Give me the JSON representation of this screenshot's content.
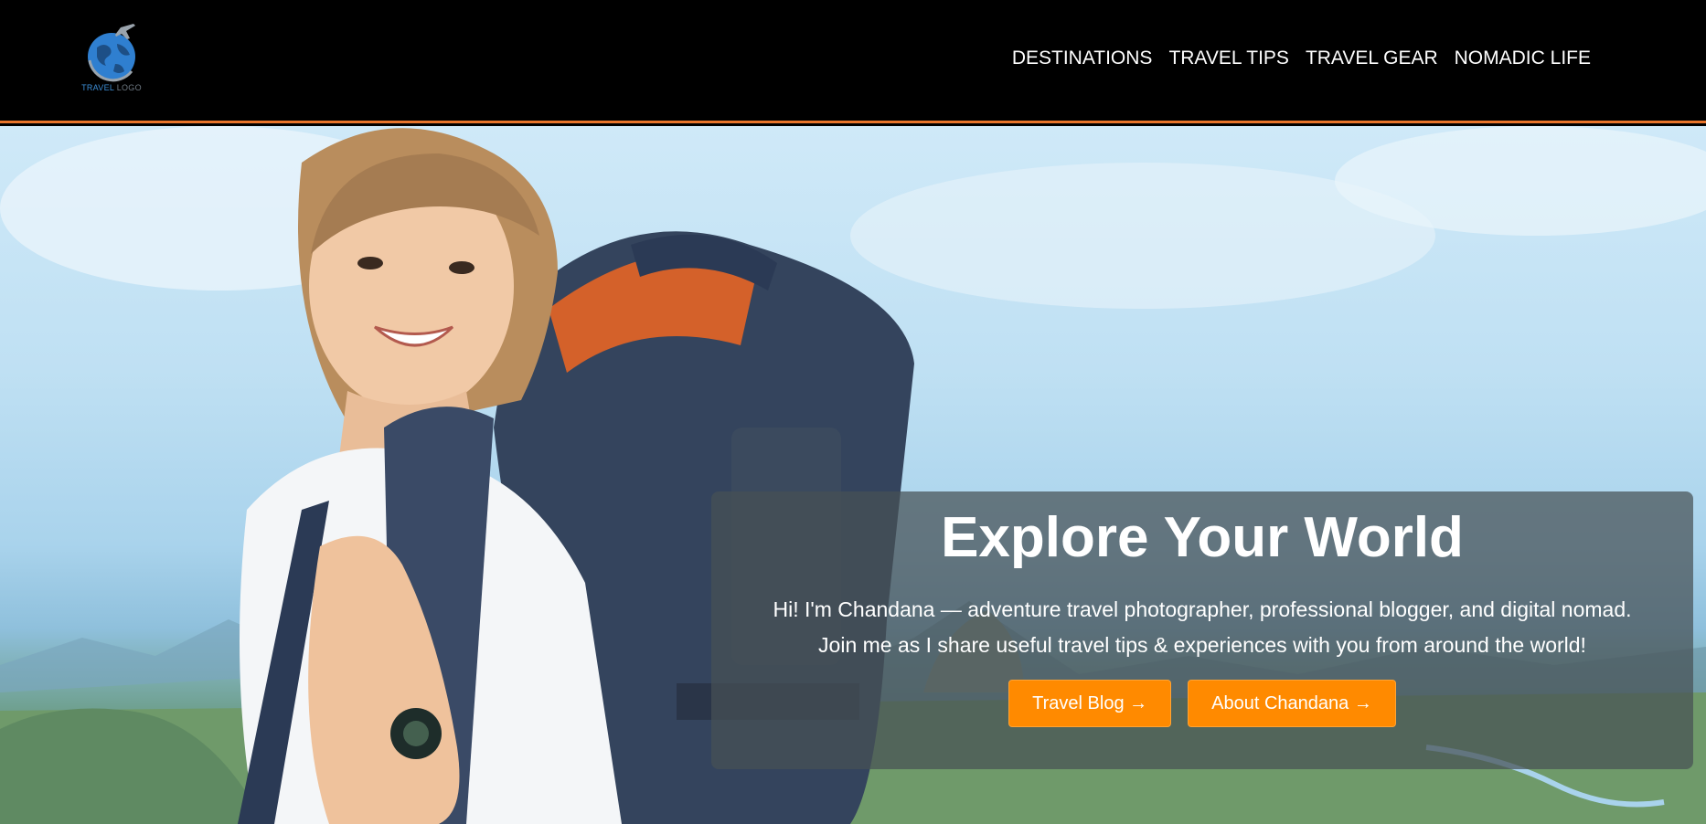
{
  "header": {
    "logo": {
      "text_primary": "TRAVEL",
      "text_secondary": "LOGO",
      "icon": "globe-plane-icon",
      "brand_color": "#3d8fd8"
    },
    "nav": [
      {
        "label": "DESTINATIONS"
      },
      {
        "label": "TRAVEL TIPS"
      },
      {
        "label": "TRAVEL GEAR"
      },
      {
        "label": "NOMADIC LIFE"
      }
    ],
    "accent_line_color": "#e8742a"
  },
  "hero": {
    "image": "smiling-backpacker-woman-mountain-view",
    "title": "Explore Your World",
    "intro_line1": "Hi! I'm Chandana — adventure travel photographer, professional blogger, and digital nomad.",
    "intro_line2": "Join me as I share useful travel tips & experiences with you from around the world!",
    "buttons": [
      {
        "label": "Travel Blog →"
      },
      {
        "label": "About Chandana →"
      }
    ],
    "button_color": "#ff8a00"
  }
}
